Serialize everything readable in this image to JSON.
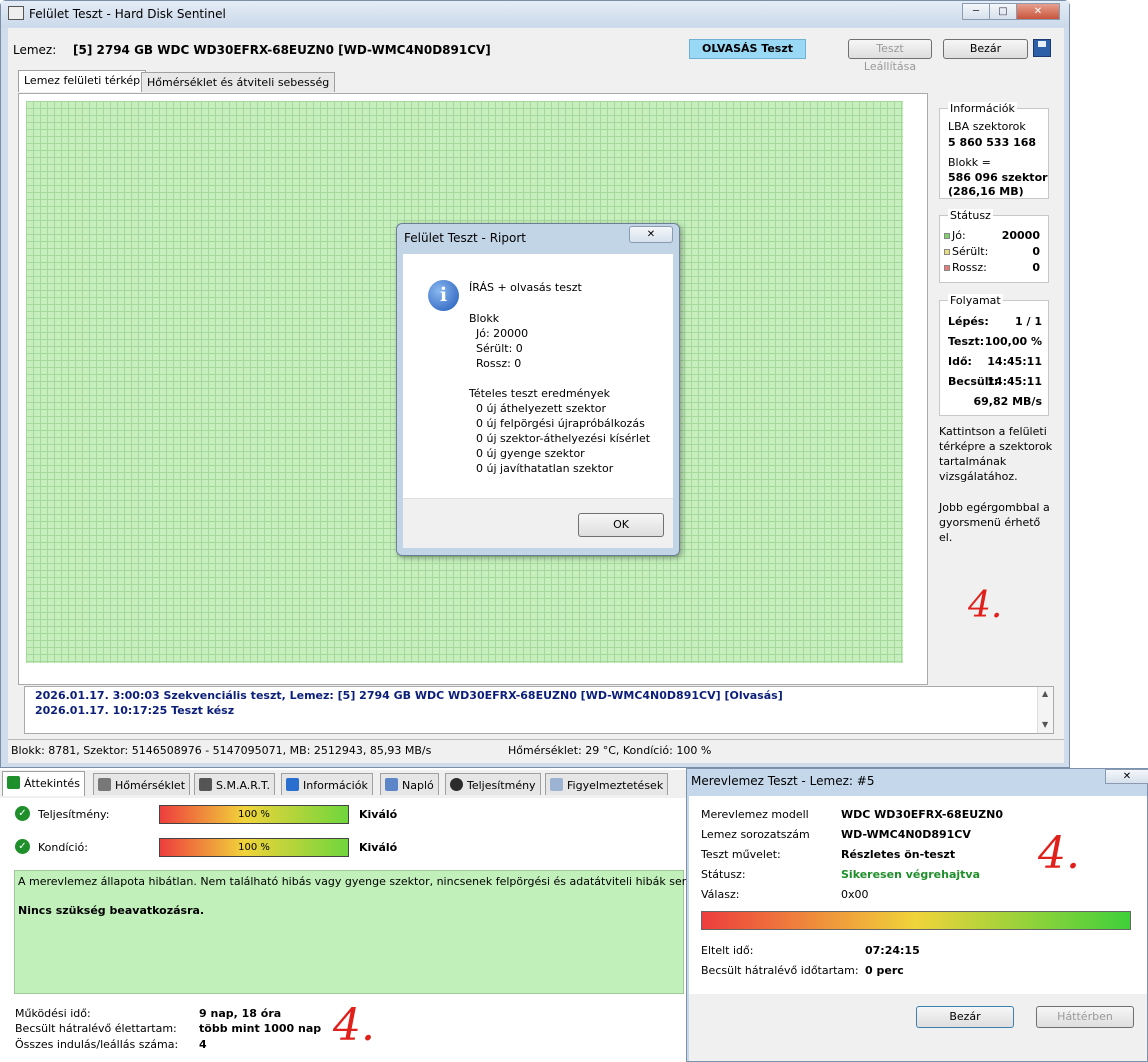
{
  "window": {
    "title": "Felület Teszt - Hard Disk Sentinel",
    "minimize": "─",
    "maximize": "□",
    "close": "✕"
  },
  "toolbar": {
    "disk_label": "Lemez:",
    "disk_value": "[5] 2794 GB  WDC WD30EFRX-68EUZN0 [WD-WMC4N0D891CV]",
    "mode": "OLVASÁS Teszt",
    "stop": "Teszt Leállítása",
    "close": "Bezár"
  },
  "tabs": [
    "Lemez felületi térkép",
    "Hőmérséklet és átviteli sebesség"
  ],
  "info": {
    "title": "Információk",
    "lba_label": "LBA szektorok",
    "lba_value": "5 860 533 168",
    "block_label": "Blokk =",
    "block_value": "586 096 szektor",
    "block_size": "(286,16 MB)"
  },
  "status": {
    "title": "Státusz",
    "good_label": "Jó:",
    "good_value": "20000",
    "damaged_label": "Sérült:",
    "damaged_value": "0",
    "bad_label": "Rossz:",
    "bad_value": "0",
    "good_color": "#7ed36a",
    "damaged_color": "#e8e07a",
    "bad_color": "#e87a7a"
  },
  "progress": {
    "title": "Folyamat",
    "step_label": "Lépés:",
    "step_value": "1 / 1",
    "test_label": "Teszt:",
    "test_value": "100,00 %",
    "time_label": "Idő:",
    "time_value": "14:45:11",
    "est_label": "Becsült:",
    "est_value": "14:45:11",
    "speed": "69,82 MB/s"
  },
  "hint1": [
    "Kattintson a felületi",
    "térképre a szektorok",
    "tartalmának",
    "vizsgálatához."
  ],
  "hint2": [
    "Jobb egérgombbal a",
    "gyorsmenü érhető",
    "el."
  ],
  "log": [
    "2026.01.17.  3:00:03   Szekvenciális teszt, Lemez: [5] 2794 GB  WDC WD30EFRX-68EUZN0 [WD-WMC4N0D891CV] [Olvasás]",
    "2026.01.17.  10:17:25   Teszt kész"
  ],
  "statusbar": {
    "left": "Blokk: 8781, Szektor: 5146508976 - 5147095071, MB: 2512943, 85,93 MB/s",
    "right": "Hőmérséklet: 29  °C,  Kondíció: 100 %"
  },
  "dialog": {
    "title": "Felület Teszt - Riport",
    "heading": "ÍRÁS + olvasás teszt",
    "lines": [
      "Blokk",
      "  Jó: 20000",
      "  Sérült: 0",
      "  Rossz: 0",
      "",
      "Tételes teszt eredmények",
      "  0 új áthelyezett szektor",
      "  0 új felpörgési újrapróbálkozás",
      "  0 új szektor-áthelyezési kísérlet",
      "  0 új gyenge szektor",
      "  0 új javíthatatlan szektor"
    ],
    "ok": "OK"
  },
  "lower": {
    "tabs": [
      "Áttekintés",
      "Hőmérséklet",
      "S.M.A.R.T.",
      "Információk",
      "Napló",
      "Teljesítmény",
      "Figyelmeztetések"
    ],
    "perf_label": "Teljesítmény:",
    "perf_value": "100 %",
    "perf_fraction": 1.0,
    "perf_rating": "Kiváló",
    "cond_label": "Kondíció:",
    "cond_value": "100 %",
    "cond_fraction": 1.0,
    "cond_rating": "Kiváló",
    "message": "A merevlemez állapota hibátlan. Nem található hibás vagy gyenge szektor, nincsenek felpörgési és adatátviteli hibák sem.",
    "message_bold": "Nincs szükség beavatkozásra.",
    "uptime_label": "Működési idő:",
    "uptime_value": "9 nap, 18 óra",
    "remaining_label": "Becsült hátralévő élettartam:",
    "remaining_value": "több mint 1000 nap",
    "starts_label": "Összes indulás/leállás száma:",
    "starts_value": "4"
  },
  "selftest": {
    "title": "Merevlemez Teszt - Lemez: #5",
    "model_label": "Merevlemez modell",
    "model_value": "WDC WD30EFRX-68EUZN0",
    "serial_label": "Lemez sorozatszám",
    "serial_value": "WD-WMC4N0D891CV",
    "op_label": "Teszt művelet:",
    "op_value": "Részletes ön-teszt",
    "status_label": "Státusz:",
    "status_value": "Sikeresen végrehajtva",
    "reply_label": "Válasz:",
    "reply_value": "0x00",
    "progress_fraction": 1.0,
    "elapsed_label": "Eltelt idő:",
    "elapsed_value": "07:24:15",
    "remaining_label": "Becsült hátralévő időtartam:",
    "remaining_value": "0 perc",
    "close": "Bezár",
    "background": "Háttérben"
  },
  "annotations": [
    "4.",
    "4.",
    "4."
  ]
}
